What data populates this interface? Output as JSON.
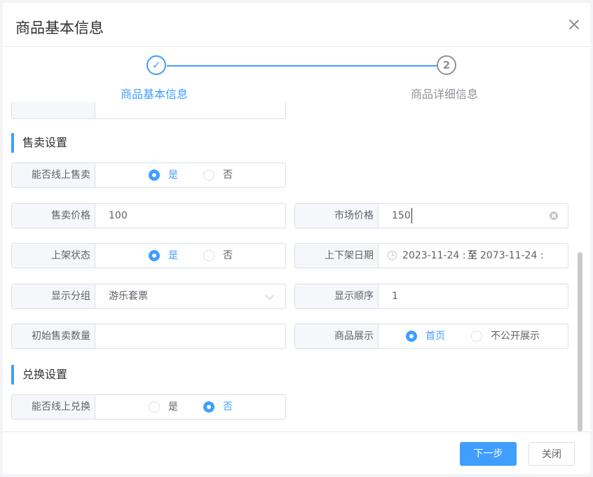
{
  "dialog": {
    "title": "商品基本信息"
  },
  "steps": [
    {
      "label": "商品基本信息",
      "status": "done"
    },
    {
      "label": "商品详细信息",
      "number": "2"
    }
  ],
  "sale_section": {
    "title": "售卖设置",
    "online_sale": {
      "label": "能否线上售卖",
      "options": [
        "是",
        "否"
      ],
      "selected": "是"
    },
    "sale_price": {
      "label": "售卖价格",
      "value": "100"
    },
    "market_price": {
      "label": "市场价格",
      "value": "150"
    },
    "listing_status": {
      "label": "上架状态",
      "options": [
        "是",
        "否"
      ],
      "selected": "是"
    },
    "listing_dates": {
      "label": "上下架日期",
      "start": "2023-11-24 :",
      "sep": "至",
      "end": "2073-11-24 :"
    },
    "display_group": {
      "label": "显示分组",
      "value": "游乐套票"
    },
    "display_order": {
      "label": "显示顺序",
      "value": "1"
    },
    "initial_sold": {
      "label": "初始售卖数量",
      "value": ""
    },
    "product_display": {
      "label": "商品展示",
      "options": [
        "首页",
        "不公开展示"
      ],
      "selected": "首页"
    }
  },
  "exchange_section": {
    "title": "兑换设置",
    "online_exchange": {
      "label": "能否线上兑换",
      "options": [
        "是",
        "否"
      ],
      "selected": "否"
    }
  },
  "footer": {
    "next_label": "下一步",
    "close_label": "关闭"
  },
  "colors": {
    "accent": "#409eff",
    "label_bg": "#f5f7fa",
    "border": "#dcdfe6"
  }
}
